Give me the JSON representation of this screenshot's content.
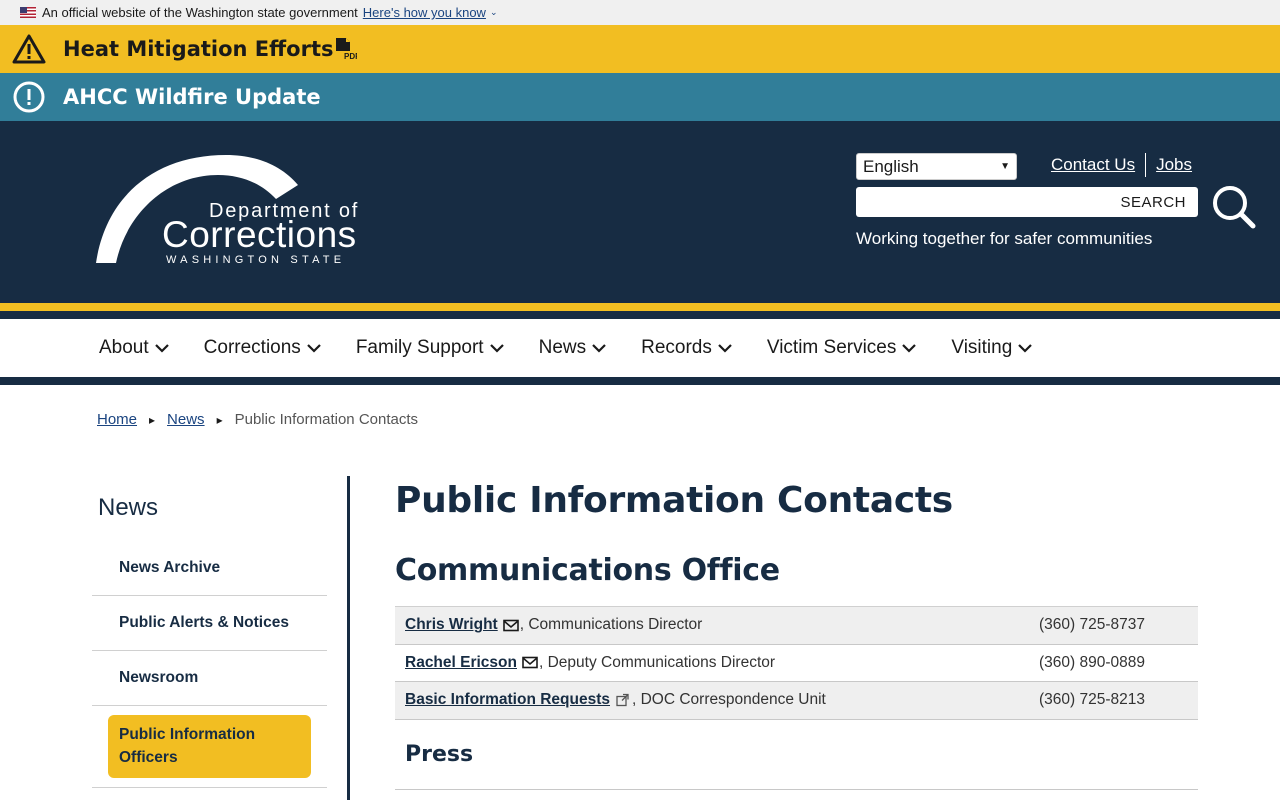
{
  "gov_banner": {
    "text": "An official website of the Washington state government",
    "link": "Here's how you know"
  },
  "alerts": [
    {
      "text": "Heat Mitigation Efforts",
      "color": "#f2be22"
    },
    {
      "text": "AHCC Wildfire Update",
      "color": "#317e99"
    }
  ],
  "header": {
    "logo_line1": "Department of",
    "logo_line2": "Corrections",
    "logo_line3": "WASHINGTON STATE",
    "language": "English",
    "links": [
      "Contact Us",
      "Jobs"
    ],
    "search_label": "SEARCH",
    "tagline": "Working together for safer communities",
    "brand_color": "#172c43",
    "accent_color": "#f2be22"
  },
  "nav": {
    "items": [
      "About",
      "Corrections",
      "Family Support",
      "News",
      "Records",
      "Victim Services",
      "Visiting"
    ]
  },
  "breadcrumb": {
    "home": "Home",
    "news": "News",
    "current": "Public Information Contacts"
  },
  "sidebar": {
    "title": "News",
    "items": [
      "News Archive",
      "Public Alerts & Notices",
      "Newsroom"
    ],
    "active": "Public Information Officers"
  },
  "main": {
    "title": "Public Information Contacts",
    "section": "Communications Office",
    "contacts": [
      {
        "name": "Chris Wright",
        "role": ", Communications Director",
        "phone": "(360) 725-8737",
        "icon": "mail-icon"
      },
      {
        "name": "Rachel Ericson",
        "role": ", Deputy Communications Director",
        "phone": "(360) 890-0889",
        "icon": "mail-icon"
      },
      {
        "name": "Basic Information Requests",
        "role": ", DOC Correspondence Unit",
        "phone": "(360) 725-8213",
        "icon": "external-link-icon"
      }
    ],
    "press_title": "Press"
  }
}
